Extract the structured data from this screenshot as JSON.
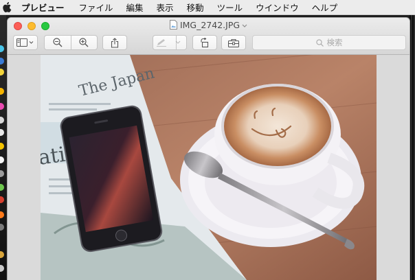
{
  "menubar": {
    "apple_icon": "apple-icon",
    "app_name": "プレビュー",
    "items": [
      "ファイル",
      "編集",
      "表示",
      "移動",
      "ツール",
      "ウインドウ",
      "ヘルプ"
    ]
  },
  "window": {
    "title": "IMG_2742.JPG",
    "doc_icon": "image-file-icon",
    "title_menu_icon": "chevron-down-icon"
  },
  "toolbar": {
    "sidebar_icon": "sidebar-icon",
    "zoom_out_icon": "zoom-out-icon",
    "zoom_in_icon": "zoom-in-icon",
    "share_icon": "share-icon",
    "markup_icon": "pen-icon",
    "rotate_icon": "rotate-left-icon",
    "toolbox_icon": "toolbox-icon",
    "search_placeholder": "検索"
  },
  "photo": {
    "subject": "photo",
    "newspaper_masthead": "The Japan",
    "newspaper_masthead_partial": "atio"
  },
  "colors": {
    "close": "#fc5f57",
    "minimize": "#fdbc2e",
    "maximize": "#28c840"
  }
}
